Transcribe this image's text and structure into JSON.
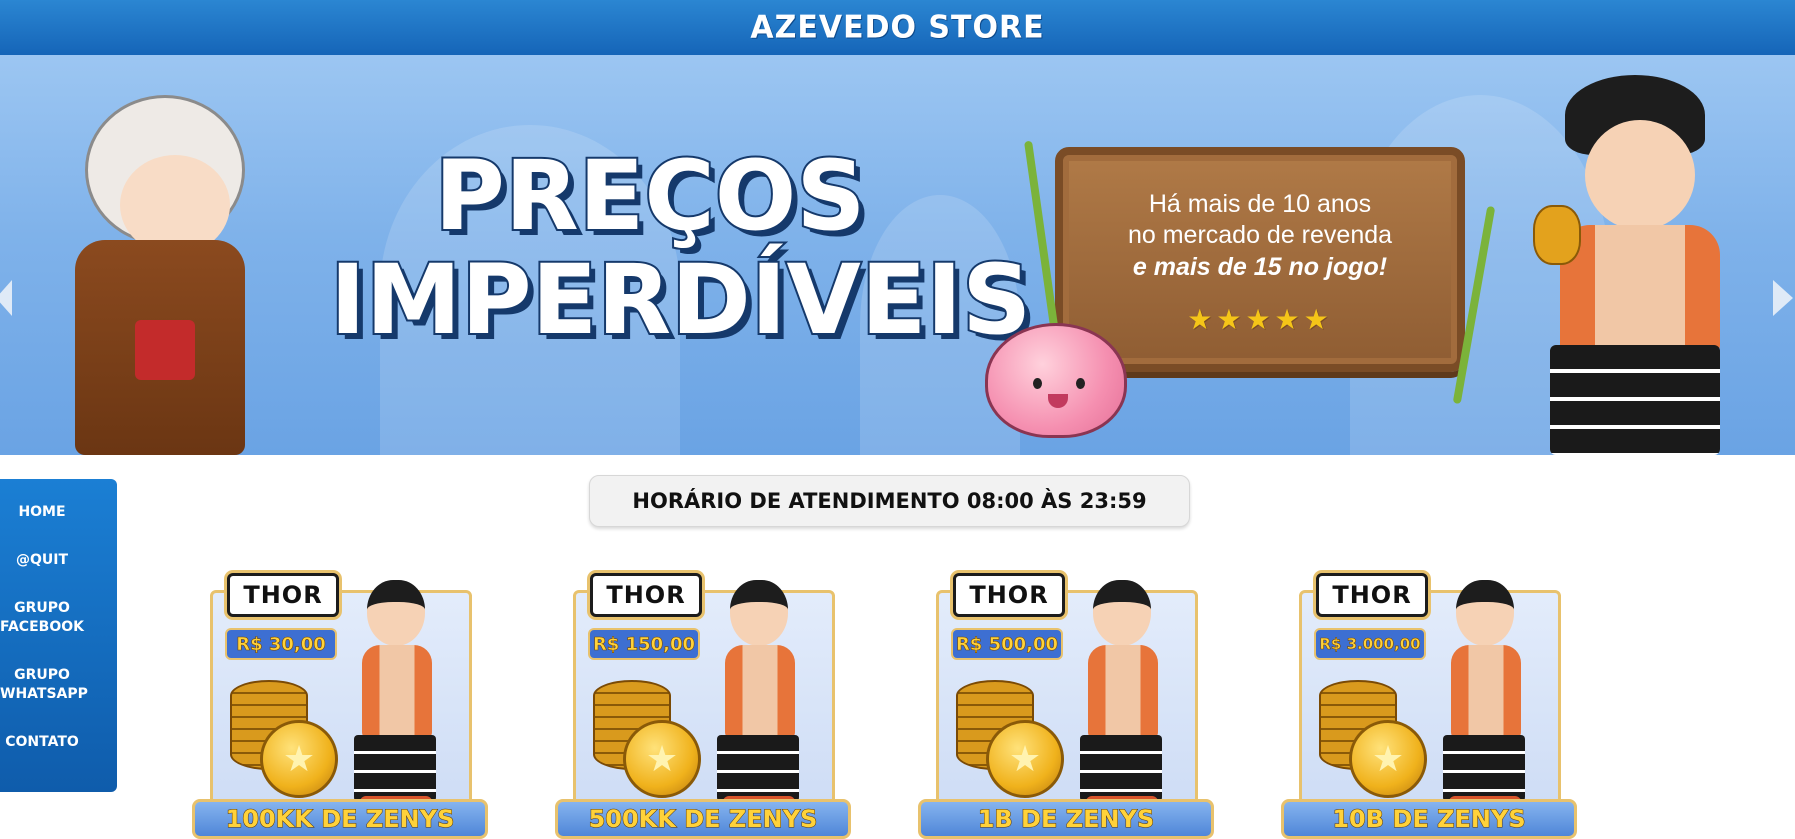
{
  "header": {
    "brand": "AZEVEDO STORE"
  },
  "banner": {
    "headline_line1": "PREÇOS",
    "headline_line2": "IMPERDÍVEIS",
    "sign_line1": "Há mais de 10 anos",
    "sign_line2": "no mercado de revenda",
    "sign_line3": "e mais de 15 no jogo!",
    "rating_stars": "★★★★★",
    "rating_value": 5
  },
  "sidebar": {
    "items": [
      {
        "label": "HOME"
      },
      {
        "label": "@QUIT"
      },
      {
        "label": "GRUPO FACEBOOK"
      },
      {
        "label": "GRUPO WHATSAPP"
      },
      {
        "label": "CONTATO"
      }
    ]
  },
  "hours": {
    "text": "HORÁRIO DE ATENDIMENTO 08:00 ÀS 23:59"
  },
  "products": [
    {
      "server": "THOR",
      "price": "R$ 30,00",
      "title": "100KK DE ZENYS"
    },
    {
      "server": "THOR",
      "price": "R$ 150,00",
      "title": "500KK DE ZENYS"
    },
    {
      "server": "THOR",
      "price": "R$ 500,00",
      "title": "1B DE ZENYS"
    },
    {
      "server": "THOR",
      "price": "R$ 3.000,00",
      "title": "10B DE ZENYS"
    }
  ],
  "colors": {
    "header_blue": "#1e78cc",
    "sidebar_blue": "#1570c4",
    "price_gold": "#ffd23a",
    "card_border_gold": "#e8c26d"
  }
}
